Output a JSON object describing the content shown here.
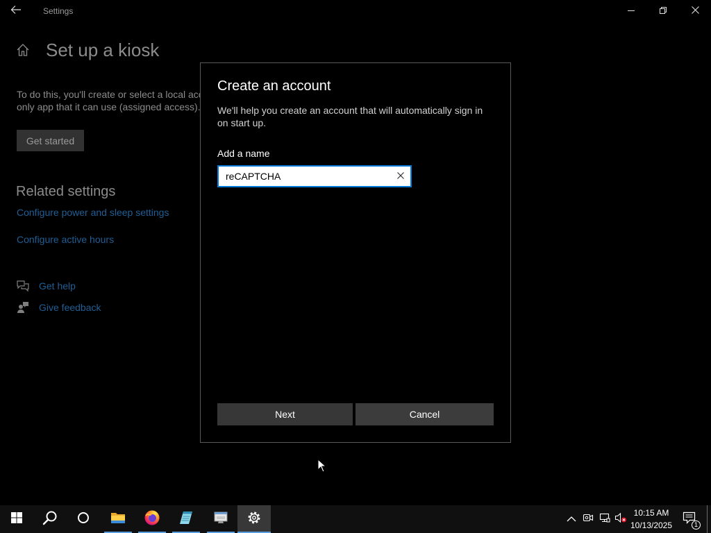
{
  "window": {
    "title": "Settings",
    "icons": {
      "back": "back-arrow-icon",
      "minimize": "minimize-icon",
      "restore": "restore-icon",
      "close": "close-icon"
    }
  },
  "page": {
    "home_icon": "home-icon",
    "heading": "Set up a kiosk",
    "description": [
      "To do this, you'll create or select a local acc",
      "only app that it can use (assigned access)."
    ],
    "get_started": "Get started",
    "related_settings": {
      "heading": "Related settings",
      "links": [
        "Configure power and sleep settings",
        "Configure active hours"
      ]
    },
    "help": {
      "get_help": "Get help",
      "get_help_icon": "get-help-icon",
      "give_feedback": "Give feedback",
      "give_feedback_icon": "give-feedback-icon"
    }
  },
  "dialog": {
    "title": "Create an account",
    "description": "We'll help you create an account that will automatically sign in on start up.",
    "name_label": "Add a name",
    "name_value": "reCAPTCHA",
    "clear_icon": "clear-icon",
    "next": "Next",
    "cancel": "Cancel"
  },
  "taskbar": {
    "start_icon": "windows-logo-icon",
    "search_icon": "search-icon",
    "cortana_icon": "cortana-icon",
    "apps": [
      {
        "icon": "file-explorer-icon",
        "running": true
      },
      {
        "icon": "firefox-icon",
        "running": true
      },
      {
        "icon": "notepad-icon",
        "running": true
      },
      {
        "icon": "computer-app-icon",
        "running": true
      },
      {
        "icon": "settings-gear-icon",
        "running": true,
        "active": true
      }
    ],
    "tray_icons": [
      "chevron-up-icon",
      "meet-now-icon",
      "network-icon",
      "volume-muted-icon"
    ],
    "clock": {
      "time": "10:15 AM",
      "date": "10/13/2025"
    },
    "notification_icon": "action-center-icon",
    "notification_count": "1"
  },
  "cursor_icon": "mouse-pointer-icon",
  "colors": {
    "accent": "#0078d7",
    "link": "#205e95",
    "taskbar_indicator": "#5aa0e0",
    "muted_badge": "#e81123",
    "background": "#000000"
  }
}
